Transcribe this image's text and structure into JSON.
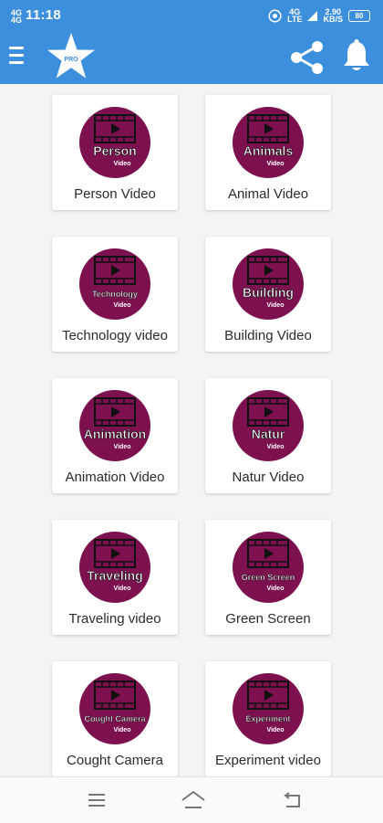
{
  "status_bar": {
    "time": "11:18",
    "sim_top": "4G",
    "sim_bottom": "4G",
    "network_top": "4G",
    "network_bottom": "LTE",
    "speed_value": "2.90",
    "speed_unit": "KB/S",
    "battery": "80"
  },
  "app_bar": {
    "logo_text": "PRO",
    "menu_icon": "hamburger-menu-icon",
    "share_icon": "share-icon",
    "bell_icon": "notification-bell-icon",
    "color": "#3c8fdd"
  },
  "categories": [
    {
      "label": "Person Video",
      "title": "Person",
      "sub": "Video"
    },
    {
      "label": "Animal Video",
      "title": "Animals",
      "sub": "Video"
    },
    {
      "label": "Technology video",
      "title": "Technology",
      "sub": "Video"
    },
    {
      "label": "Building Video",
      "title": "Building",
      "sub": "Video"
    },
    {
      "label": "Animation Video",
      "title": "Animation",
      "sub": "Video"
    },
    {
      "label": "Natur Video",
      "title": "Natur",
      "sub": "Video"
    },
    {
      "label": "Traveling video",
      "title": "Traveling",
      "sub": "Video"
    },
    {
      "label": "Green Screen",
      "title": "Green Screen",
      "sub": "Video"
    },
    {
      "label": "Cought Camera",
      "title": "Cought Camera",
      "sub": "Video"
    },
    {
      "label": "Experiment video",
      "title": "Experiment",
      "sub": "Video"
    }
  ],
  "theme": {
    "circle_color": "#7d1150",
    "card_bg": "#ffffff"
  },
  "nav_bar": {
    "menu_icon": "recents-icon",
    "home_icon": "home-icon",
    "back_icon": "back-icon"
  }
}
